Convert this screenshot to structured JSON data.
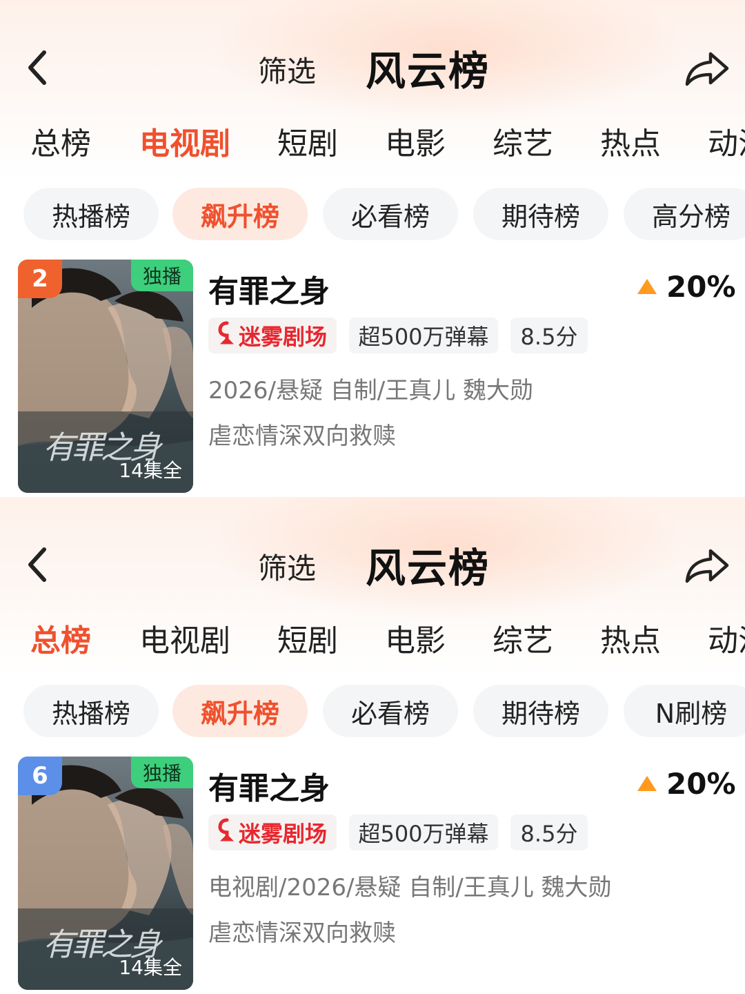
{
  "panels": [
    {
      "header": {
        "filter_label": "筛选",
        "title": "风云榜"
      },
      "category_tabs": [
        "总榜",
        "电视剧",
        "短剧",
        "电影",
        "综艺",
        "热点",
        "动漫"
      ],
      "active_category": 1,
      "list_pills": [
        "热播榜",
        "飙升榜",
        "必看榜",
        "期待榜",
        "高分榜"
      ],
      "active_pill": 1,
      "item": {
        "rank": "2",
        "rank_color": "#f0622d",
        "exclusive_badge": "独播",
        "episodes": "14集全",
        "poster_title": "有罪之身",
        "name": "有罪之身",
        "trend_value": "20%",
        "theater_tag": "迷雾剧场",
        "danmaku_tag": "超500万弹幕",
        "score_tag": "8.5分",
        "meta": "2026/悬疑 自制/王真儿 魏大勋",
        "description": "虐恋情深双向救赎"
      }
    },
    {
      "header": {
        "filter_label": "筛选",
        "title": "风云榜"
      },
      "category_tabs": [
        "总榜",
        "电视剧",
        "短剧",
        "电影",
        "综艺",
        "热点",
        "动漫"
      ],
      "active_category": 0,
      "list_pills": [
        "热播榜",
        "飙升榜",
        "必看榜",
        "期待榜",
        "N刷榜"
      ],
      "active_pill": 1,
      "item": {
        "rank": "6",
        "rank_color": "#5b8fe8",
        "exclusive_badge": "独播",
        "episodes": "14集全",
        "poster_title": "有罪之身",
        "name": "有罪之身",
        "trend_value": "20%",
        "theater_tag": "迷雾剧场",
        "danmaku_tag": "超500万弹幕",
        "score_tag": "8.5分",
        "meta": "电视剧/2026/悬疑 自制/王真儿 魏大勋",
        "description": "虐恋情深双向救赎"
      }
    }
  ],
  "colors": {
    "accent": "#f0502d",
    "trend_up": "#ff9a1f",
    "exclusive": "#3ecf7c",
    "theater": "#e8272f"
  },
  "icons": {
    "back": "chevron-left-icon",
    "share": "share-arrow-icon",
    "trend": "triangle-up-icon",
    "theater": "theater-logo-icon"
  }
}
